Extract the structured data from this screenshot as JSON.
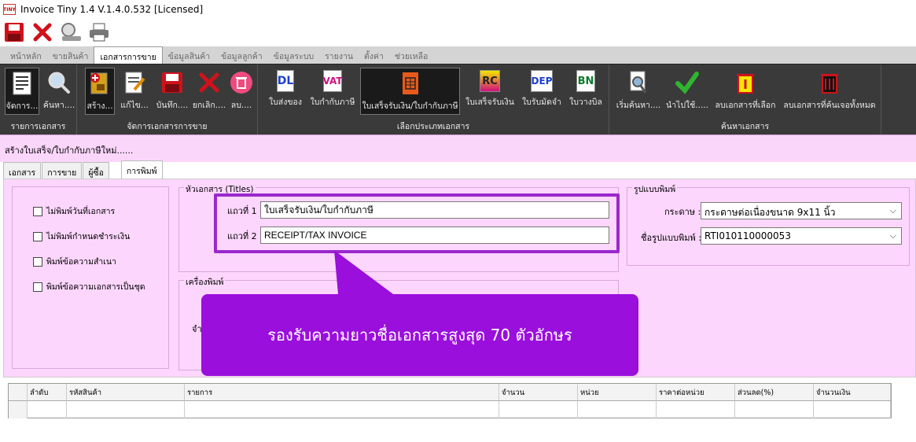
{
  "window": {
    "title": "Invoice Tiny 1.4  V.1.4.0.532 [Licensed]",
    "logo_text": "TINY"
  },
  "quick_toolbar": [
    {
      "name": "save-icon"
    },
    {
      "name": "close-icon"
    },
    {
      "name": "search-user-icon"
    },
    {
      "name": "printer-icon"
    }
  ],
  "menu_tabs": [
    "หน้าหลัก",
    "ขายสินค้า",
    "เอกสารการขาย",
    "ข้อมูลสินค้า",
    "ข้อมูลลูกค้า",
    "ข้อมูลระบบ",
    "รายงาน",
    "ตั้งค่า",
    "ช่วยเหลือ"
  ],
  "ribbon": {
    "groups": [
      {
        "label": "รายการเอกสาร",
        "buttons": [
          "จัดการ...",
          "ค้นหา...."
        ]
      },
      {
        "label": "จัดการเอกสารการขาย",
        "buttons": [
          "สร้าง...",
          "แก้ไข...",
          "บันทึก....",
          "ยกเลิก....",
          "ลบ...."
        ]
      },
      {
        "label": "เลือกประเภทเอกสาร",
        "buttons": [
          "ใบส่งของ",
          "ใบกำกับภาษี",
          "ใบเสร็จรับเงิน/ใบกำกับภาษี",
          "ใบเสร็จรับเงิน",
          "ใบรับมัดจำ",
          "ใบวางบิล"
        ]
      },
      {
        "label": "ค้นหาเอกสาร",
        "buttons": [
          "เริ่มค้นหา....",
          "นำไปใช้.....",
          "ลบเอกสารที่เลือก",
          "ลบเอกสารที่ค้นเจอทั้งหมด"
        ]
      }
    ],
    "doc_icon_labels": {
      "dl": "DL",
      "vat": "VAT",
      "rc": "RC",
      "dep": "DEP",
      "bn": "BN"
    },
    "colors": {
      "background": "#3a3a3a",
      "dl": "#1e3fcc",
      "vat": "#d0107d",
      "rc": "#222",
      "dep": "#1e3fcc",
      "bn": "#0b7a2e"
    }
  },
  "create_bar": {
    "text": "สร้างใบเสร็จ/ใบกำกับภาษีใหม่......"
  },
  "form_tabs": [
    "เอกสาร",
    "การขาย",
    "ผู้ซื้อ",
    "การพิมพ์"
  ],
  "options": [
    {
      "label": "ไม่พิมพ์วันที่เอกสาร",
      "checked": false
    },
    {
      "label": "ไม่พิมพ์กำหนดชำระเงิน",
      "checked": false
    },
    {
      "label": "พิมพ์ข้อความสำเนา",
      "checked": false
    },
    {
      "label": "พิมพ์ข้อความเอกสารเป็นชุด",
      "checked": false
    }
  ],
  "titles_group": {
    "legend": "หัวเอกสาร (Titles)",
    "line1_label": "แถวที่ 1",
    "line1_value": "ใบเสร็จรับเงิน/ใบกำกับภาษี",
    "line2_label": "แถวที่ 2",
    "line2_value": "RECEIPT/TAX INVOICE"
  },
  "printer_group": {
    "legend": "เครื่องพิมพ์",
    "partial_label": "จำ"
  },
  "format_group": {
    "legend": "รูปแบบพิมพ์",
    "paper_label": "กระดาษ :",
    "paper_value": "กระดาษต่อเนื่องขนาด 9x11 นิ้ว",
    "format_label": "ชื่อรูปแบบพิมพ์ :",
    "format_value": "RTI010110000053"
  },
  "callout": {
    "text": "รองรับความยาวชื่อเอกสารสูงสุด 70 ตัวอักษร",
    "color": "#9a0fdb"
  },
  "grid": {
    "columns": [
      "ลำดับ",
      "รหัสสินค้า",
      "รายการ",
      "จำนวน",
      "หน่วย",
      "ราคาต่อหน่วย",
      "ส่วนลด(%)",
      "จำนวนเงิน"
    ]
  }
}
